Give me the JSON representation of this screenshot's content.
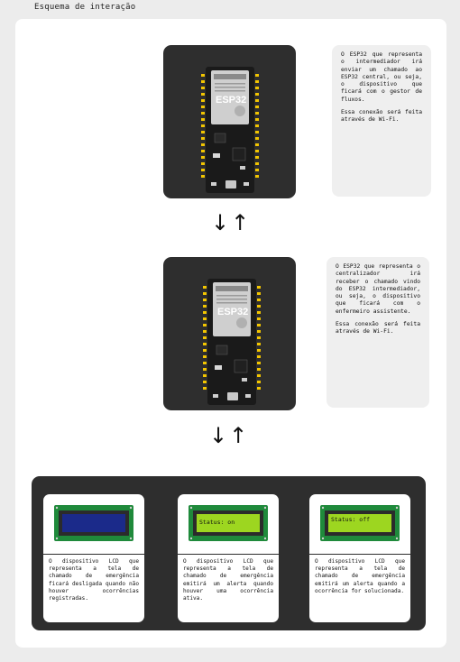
{
  "page_title": "Esquema de interação",
  "boards": {
    "top_label": "ESP32",
    "middle_label": "ESP32"
  },
  "notes": {
    "top": {
      "p1": "O ESP32 que representa o intermediador irá enviar um chamado ao ESP32 central, ou seja, o dispositivo que ficará com o gestor de fluxos.",
      "p2": "Essa conexão será feita através de Wi-Fi."
    },
    "middle": {
      "p1": "O ESP32 que representa o centralizador irá receber o chamado vindo do ESP32 intermediador, ou seja, o dispositivo que ficará com o enfermeiro assistente.",
      "p2": "Essa conexão será feita através de Wi-Fi."
    }
  },
  "arrows": {
    "first": "↓↑",
    "second": "↓↑"
  },
  "lcds": [
    {
      "screen_text": "",
      "screen_color": "#1b2a8a",
      "description": "O dispositivo LCD que representa a tela de chamado de emergência ficará desligada quando não houver ocorrências registradas."
    },
    {
      "screen_text": "Status: on",
      "screen_color": "#9dd620",
      "description": "O dispositivo LCD que representa a tela de chamado de emergência emitirá um alerta quando houver uma ocorrência ativa."
    },
    {
      "screen_text": "Status: off",
      "screen_color": "#9dd620",
      "description": "O dispositivo LCD que representa a tela de chamado de emergência emitirá um alerta quando a ocorrência for solucionada."
    }
  ],
  "colors": {
    "dark_tile": "#2e2e2e",
    "pcb_green": "#1f8a3b",
    "lcd_frame": "#2b2b2b"
  }
}
